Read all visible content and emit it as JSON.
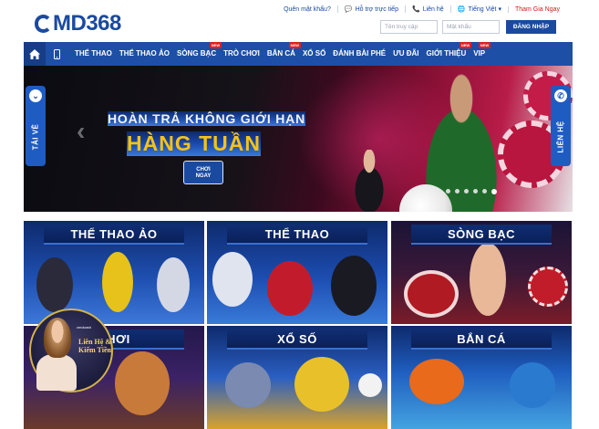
{
  "brand": {
    "logo_prefix": "C",
    "logo_text": "MD368"
  },
  "top_links": [
    {
      "icon": "",
      "label": "Quên mật khẩu?"
    },
    {
      "icon": "💬",
      "label": "Hỗ trợ trực tiếp"
    },
    {
      "icon": "📞",
      "label": "Liên hệ"
    },
    {
      "icon": "🌐",
      "label": "Tiếng Việt ▾"
    },
    {
      "icon": "",
      "label": "Tham Gia Ngay"
    }
  ],
  "login": {
    "username_placeholder": "Tên truy cập",
    "password_placeholder": "Mật khẩu",
    "submit_label": "ĐĂNG NHẬP"
  },
  "nav": {
    "items": [
      {
        "label": "THỂ THAO",
        "new": false
      },
      {
        "label": "THỂ THAO ẢO",
        "new": false
      },
      {
        "label": "SÒNG BẠC",
        "new": true
      },
      {
        "label": "TRÒ CHƠI",
        "new": false
      },
      {
        "label": "BẮN CÁ",
        "new": true
      },
      {
        "label": "XỔ SỐ",
        "new": false
      },
      {
        "label": "ĐÁNH BÀI PHÉ",
        "new": false
      },
      {
        "label": "ƯU ĐÃI",
        "new": false
      },
      {
        "label": "GIỚI THIỆU",
        "new": true
      },
      {
        "label": "VIP",
        "new": true
      }
    ],
    "new_badge": "NEW"
  },
  "banner": {
    "line1": "HOÀN TRẢ KHÔNG GIỚI HẠN",
    "line2": "HÀNG TUẦN",
    "cta_line1": "CHƠI",
    "cta_line2": "NGAY",
    "slides": 6,
    "active_slide": 6
  },
  "side_tabs": {
    "left": "TẢI VỀ",
    "right": "LIÊN HỆ"
  },
  "tiles": [
    {
      "title": "THỂ THAO ẢO"
    },
    {
      "title": "THỂ THAO"
    },
    {
      "title": "SÒNG BẠC"
    },
    {
      "title": "CHƠI"
    },
    {
      "title": "XỔ SỐ"
    },
    {
      "title": "BẮN CÁ"
    }
  ],
  "promo": {
    "small_text": "cmdcash",
    "line1": "Liên Hệ &",
    "line2": "Kiếm Tiền"
  }
}
